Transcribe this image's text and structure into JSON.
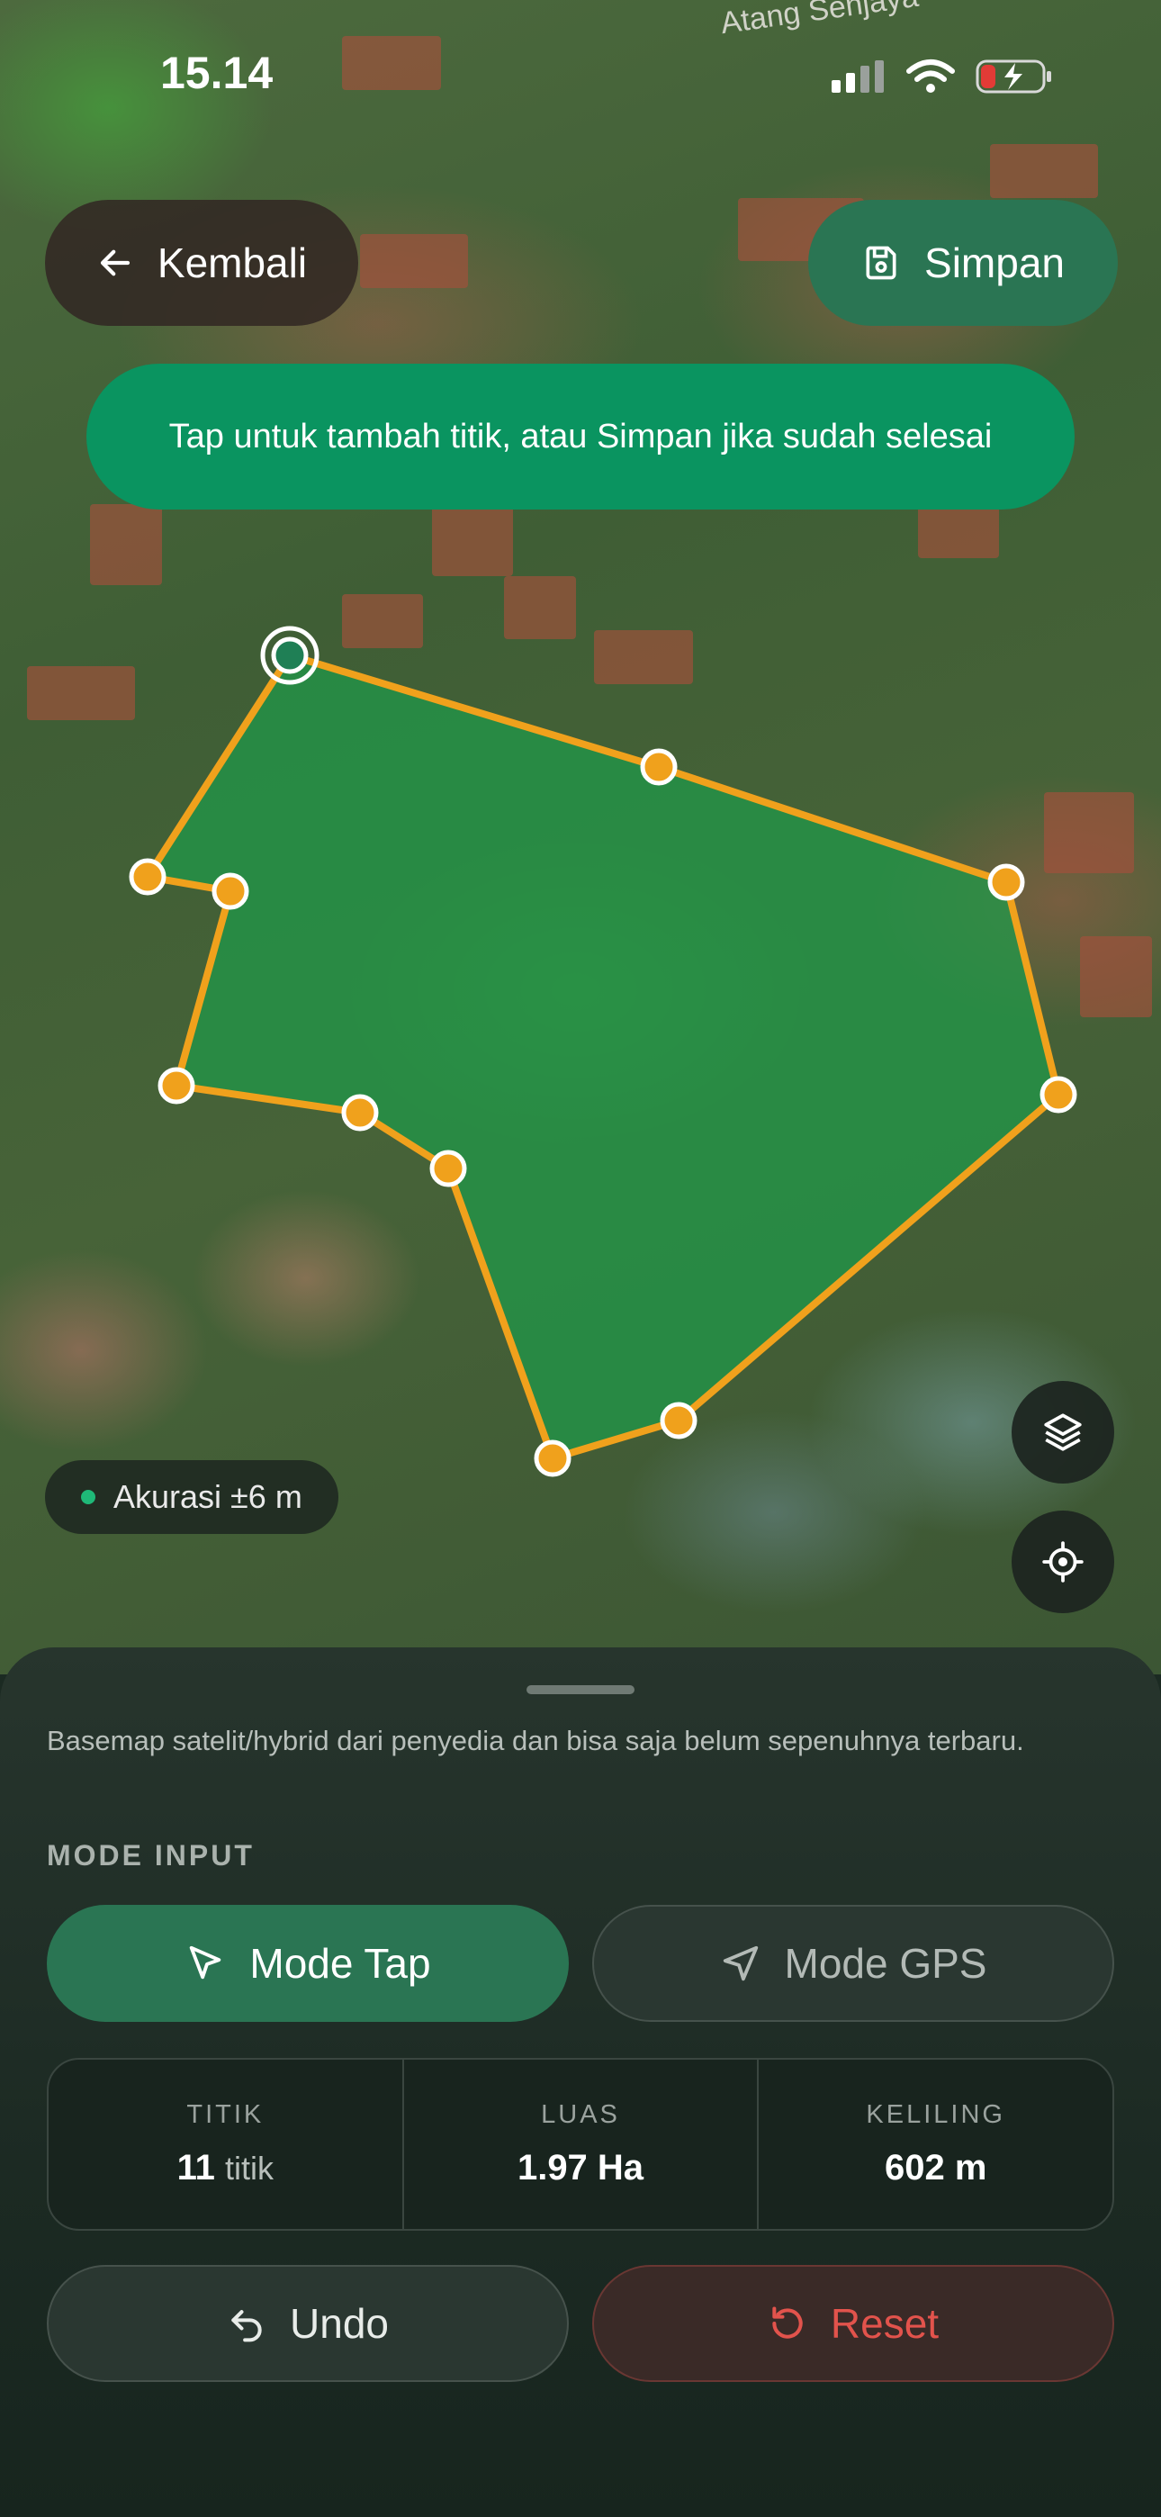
{
  "status_bar": {
    "time": "15.14"
  },
  "map": {
    "street_label": "Atang Senjaya",
    "basemap": "satellite-hybrid",
    "polygon_fill": "#1e9a4a",
    "polygon_stroke": "#f0a11c",
    "accuracy_text": "Akurasi ±6 m"
  },
  "header": {
    "back_label": "Kembali",
    "save_label": "Simpan"
  },
  "hint_text": "Tap untuk tambah titik, atau Simpan jika sudah selesai",
  "sheet": {
    "note": "Basemap satelit/hybrid dari penyedia dan bisa saja belum sepenuhnya terbaru.",
    "mode_title": "MODE INPUT",
    "mode_tap_label": "Mode Tap",
    "mode_gps_label": "Mode GPS",
    "active_mode": "Mode Tap",
    "stats": {
      "points_label": "TITIK",
      "points_value": "11",
      "points_unit": "titik",
      "area_label": "LUAS",
      "area_value": "1.97 Ha",
      "perimeter_label": "KELILING",
      "perimeter_value": "602 m"
    },
    "undo_label": "Undo",
    "reset_label": "Reset"
  },
  "colors": {
    "accent": "#2a7553",
    "hint_bg": "#0a9460",
    "reset": "#e2534c"
  },
  "icons": [
    "arrow-left-icon",
    "save-icon",
    "layers-icon",
    "locate-icon",
    "cursor-icon",
    "navigation-icon",
    "undo-icon",
    "reset-icon",
    "signal-icon",
    "wifi-icon",
    "battery-icon"
  ]
}
